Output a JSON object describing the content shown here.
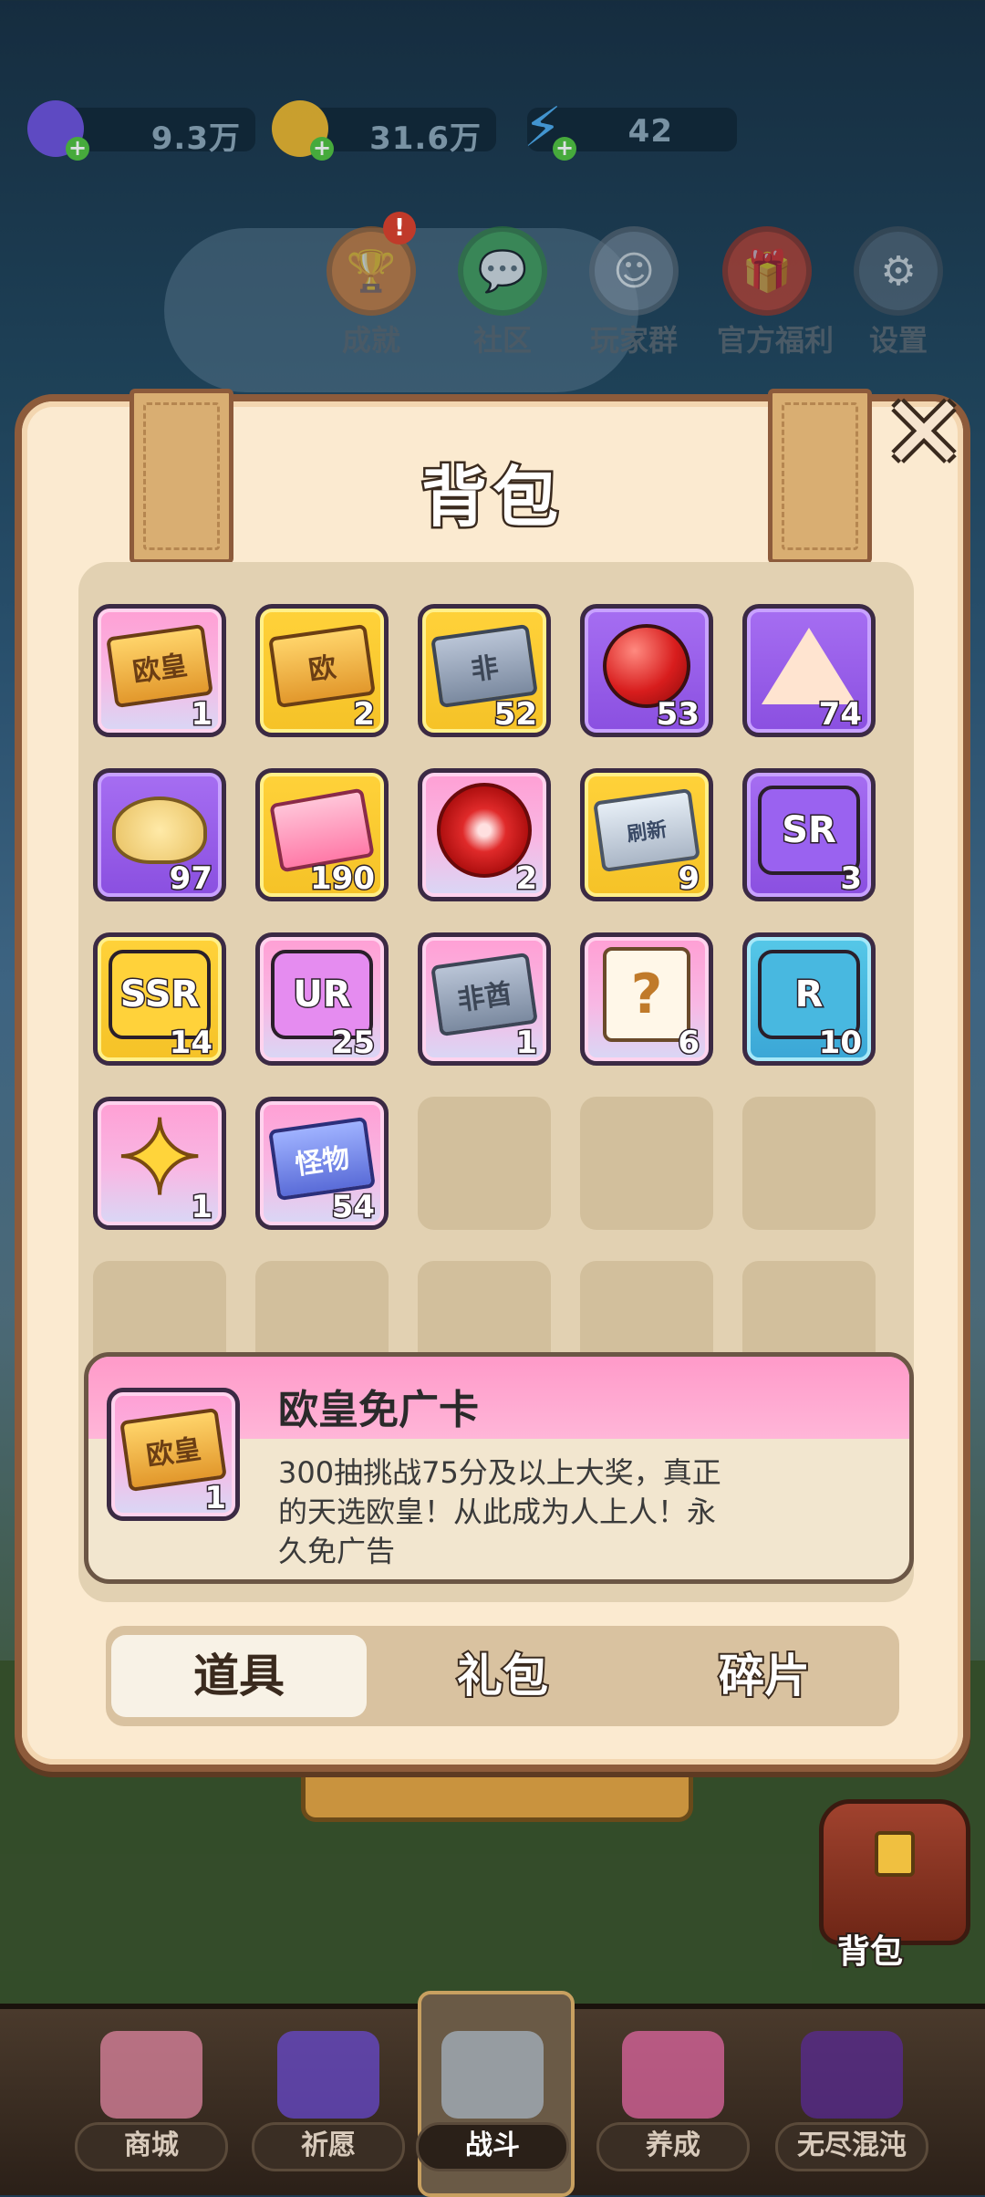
{
  "resources": [
    {
      "name": "gem-icon",
      "value": "9.3万",
      "color": "#6b4fd8"
    },
    {
      "name": "coin-icon",
      "value": "31.6万",
      "color": "#e8b22a"
    },
    {
      "name": "energy-icon",
      "value": "42",
      "color": "#4aa6e8"
    }
  ],
  "top_menu": [
    {
      "label": "成就",
      "icon": "trophy-icon",
      "color": "#e07a2a",
      "badge": "!"
    },
    {
      "label": "社区",
      "icon": "community-icon",
      "color": "#3aa64a"
    },
    {
      "label": "玩家群",
      "icon": "qq-icon",
      "color": "#7a8a9a"
    },
    {
      "label": "官方福利",
      "icon": "gift-icon",
      "color": "#d8402a"
    },
    {
      "label": "设置",
      "icon": "gear-icon",
      "color": "#5a6a7a"
    }
  ],
  "modal": {
    "title": "背包",
    "close_icon": "close-icon"
  },
  "items": [
    {
      "id": "ouhuang-card",
      "text": "欧皇",
      "count": "1",
      "frame": "pink",
      "kind": "ticket"
    },
    {
      "id": "ou-card",
      "text": "欧",
      "count": "2",
      "frame": "gold",
      "kind": "ticket"
    },
    {
      "id": "fei-card",
      "text": "非",
      "count": "52",
      "frame": "gold",
      "kind": "ticket-grey"
    },
    {
      "id": "apple",
      "text": "",
      "count": "53",
      "frame": "purple",
      "kind": "apple"
    },
    {
      "id": "cake",
      "text": "",
      "count": "74",
      "frame": "purple",
      "kind": "cake"
    },
    {
      "id": "chips",
      "text": "",
      "count": "97",
      "frame": "purple",
      "kind": "chips"
    },
    {
      "id": "pink-ticket",
      "text": "",
      "count": "190",
      "frame": "gold",
      "kind": "pink-ticket"
    },
    {
      "id": "flower",
      "text": "",
      "count": "2",
      "frame": "pink",
      "kind": "flower"
    },
    {
      "id": "refresh-card",
      "text": "刷新",
      "count": "9",
      "frame": "gold",
      "kind": "ticket-white"
    },
    {
      "id": "sr-fragment",
      "text": "SR",
      "count": "3",
      "frame": "purple",
      "kind": "puzzle-purple"
    },
    {
      "id": "ssr-fragment",
      "text": "SSR",
      "count": "14",
      "frame": "gold",
      "kind": "puzzle-gold"
    },
    {
      "id": "ur-fragment",
      "text": "UR",
      "count": "25",
      "frame": "pink",
      "kind": "puzzle-pink"
    },
    {
      "id": "feiqiu-card",
      "text": "非酋",
      "count": "1",
      "frame": "pink",
      "kind": "ticket-grey"
    },
    {
      "id": "mystery-scroll",
      "text": "?",
      "count": "6",
      "frame": "pink",
      "kind": "scroll"
    },
    {
      "id": "r-fragment",
      "text": "R",
      "count": "10",
      "frame": "blue",
      "kind": "puzzle-blue"
    },
    {
      "id": "star",
      "text": "✦",
      "count": "1",
      "frame": "pink",
      "kind": "star"
    },
    {
      "id": "monster-ticket",
      "text": "怪物",
      "count": "54",
      "frame": "pink",
      "kind": "ticket-blue"
    }
  ],
  "empty_slots": 8,
  "description": {
    "title": "欧皇免广卡",
    "text": "300抽挑战75分及以上大奖，真正的天选欧皇！从此成为人上人！永久免广告",
    "item_text": "欧皇",
    "item_count": "1"
  },
  "tabs": [
    {
      "label": "道具",
      "active": true
    },
    {
      "label": "礼包",
      "active": false
    },
    {
      "label": "碎片",
      "active": false
    }
  ],
  "side_bag_label": "背包",
  "bottom_nav": [
    {
      "label": "商城",
      "icon": "shop-icon",
      "color": "#e88aa8"
    },
    {
      "label": "祈愿",
      "icon": "wish-card-icon",
      "color": "#6a4ad8"
    },
    {
      "label": "战斗",
      "icon": "crossed-swords-icon",
      "color": "#aab8c8",
      "active": true
    },
    {
      "label": "养成",
      "icon": "paw-icon",
      "color": "#e86aa8"
    },
    {
      "label": "无尽混沌",
      "icon": "vortex-icon",
      "color": "#5a2a9a"
    }
  ]
}
